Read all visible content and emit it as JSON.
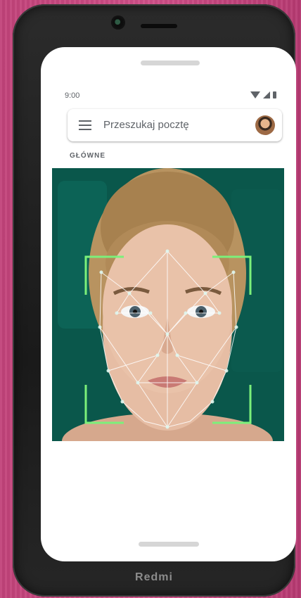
{
  "device": {
    "brand": "Redmi"
  },
  "status_bar": {
    "time": "9:00",
    "icons": [
      "wifi-icon",
      "signal-icon",
      "battery-icon"
    ]
  },
  "search": {
    "placeholder": "Przeszukaj pocztę",
    "menu_icon": "hamburger-menu-icon",
    "avatar": "account-avatar"
  },
  "inbox": {
    "section_label": "GŁÓWNE"
  },
  "media": {
    "description_icon": "face-recognition-image",
    "accent_color": "#7cf07a"
  }
}
